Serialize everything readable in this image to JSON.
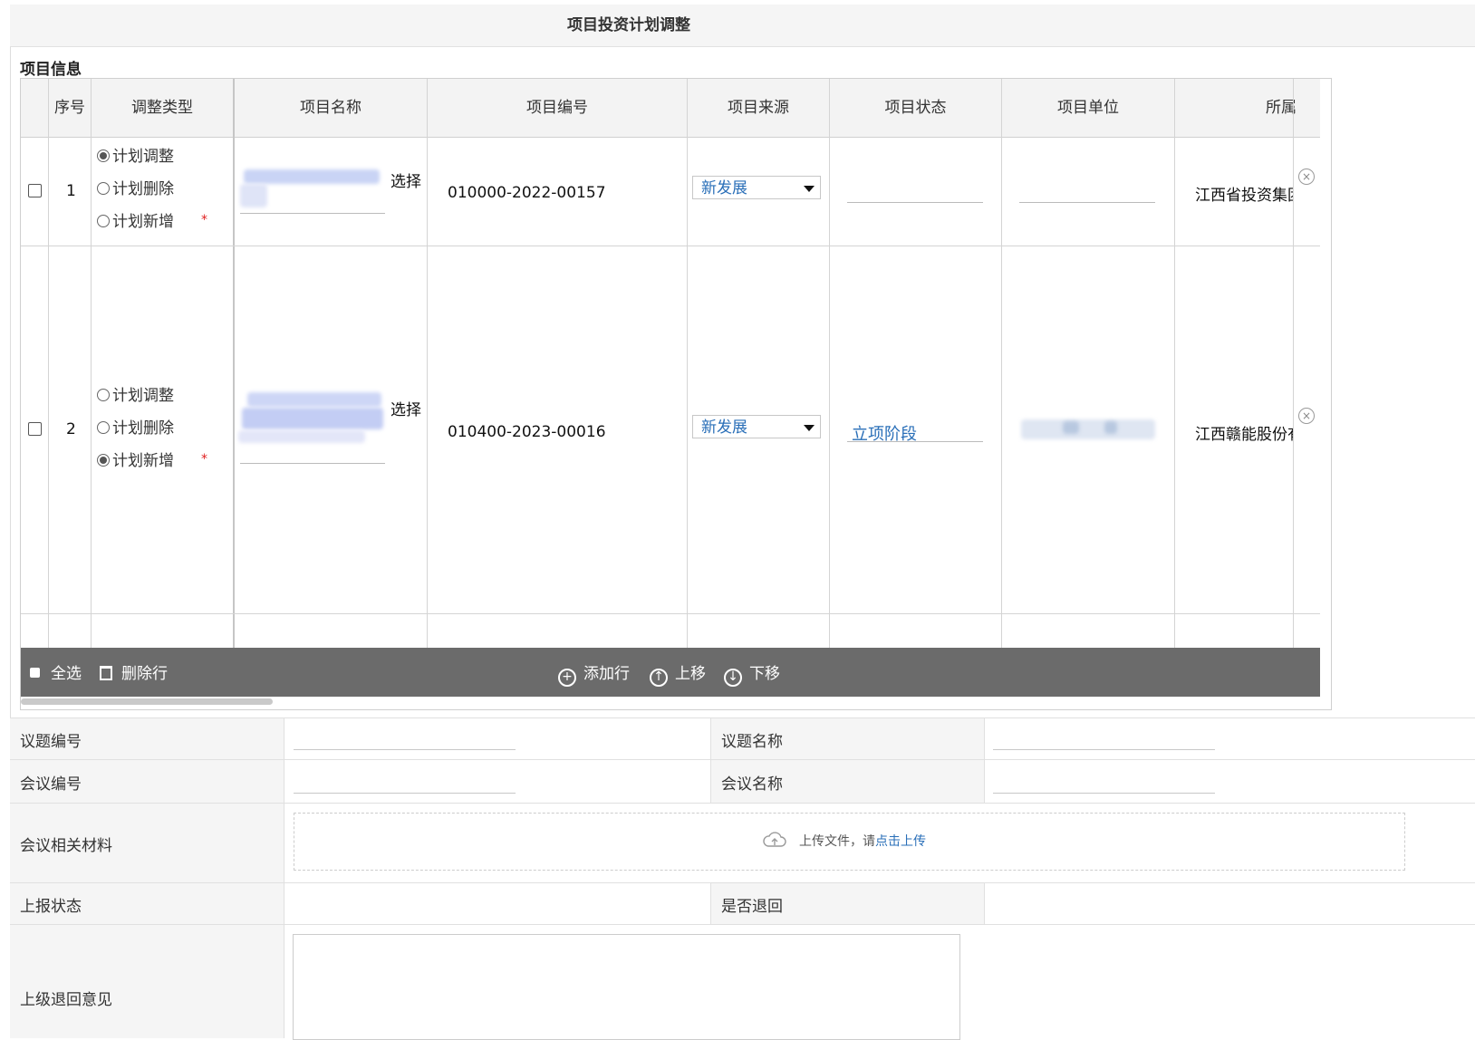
{
  "page": {
    "title": "项目投资计划调整",
    "section_label": "项目信息"
  },
  "grid": {
    "headers": [
      "序号",
      "调整类型",
      "项目名称",
      "项目编号",
      "项目来源",
      "项目状态",
      "项目单位",
      "所属"
    ],
    "rows": [
      {
        "seq": "1",
        "adjust_options": [
          "计划调整",
          "计划删除",
          "计划新增"
        ],
        "selected": 0,
        "select_label": "选择",
        "code": "010000-2022-00157",
        "source": "新发展",
        "status": "",
        "unit": "",
        "owner": "江西省投资集团"
      },
      {
        "seq": "2",
        "adjust_options": [
          "计划调整",
          "计划删除",
          "计划新增"
        ],
        "selected": 2,
        "select_label": "选择",
        "code": "010400-2023-00016",
        "source": "新发展",
        "status": "立项阶段",
        "unit": "",
        "owner": "江西赣能股份有"
      }
    ],
    "required_mark": "*",
    "remove_icon": "×"
  },
  "toolbar": {
    "select_all": "全选",
    "delete_row": "删除行",
    "add_row": "添加行",
    "move_up": "上移",
    "move_down": "下移"
  },
  "form": {
    "topic_no_label": "议题编号",
    "topic_name_label": "议题名称",
    "meeting_no_label": "会议编号",
    "meeting_name_label": "会议名称",
    "materials_label": "会议相关材料",
    "upload_prompt": "上传文件，请",
    "upload_link": "点击上传",
    "report_status_label": "上报状态",
    "returned_label": "是否退回",
    "superior_opinion_label": "上级退回意见"
  }
}
